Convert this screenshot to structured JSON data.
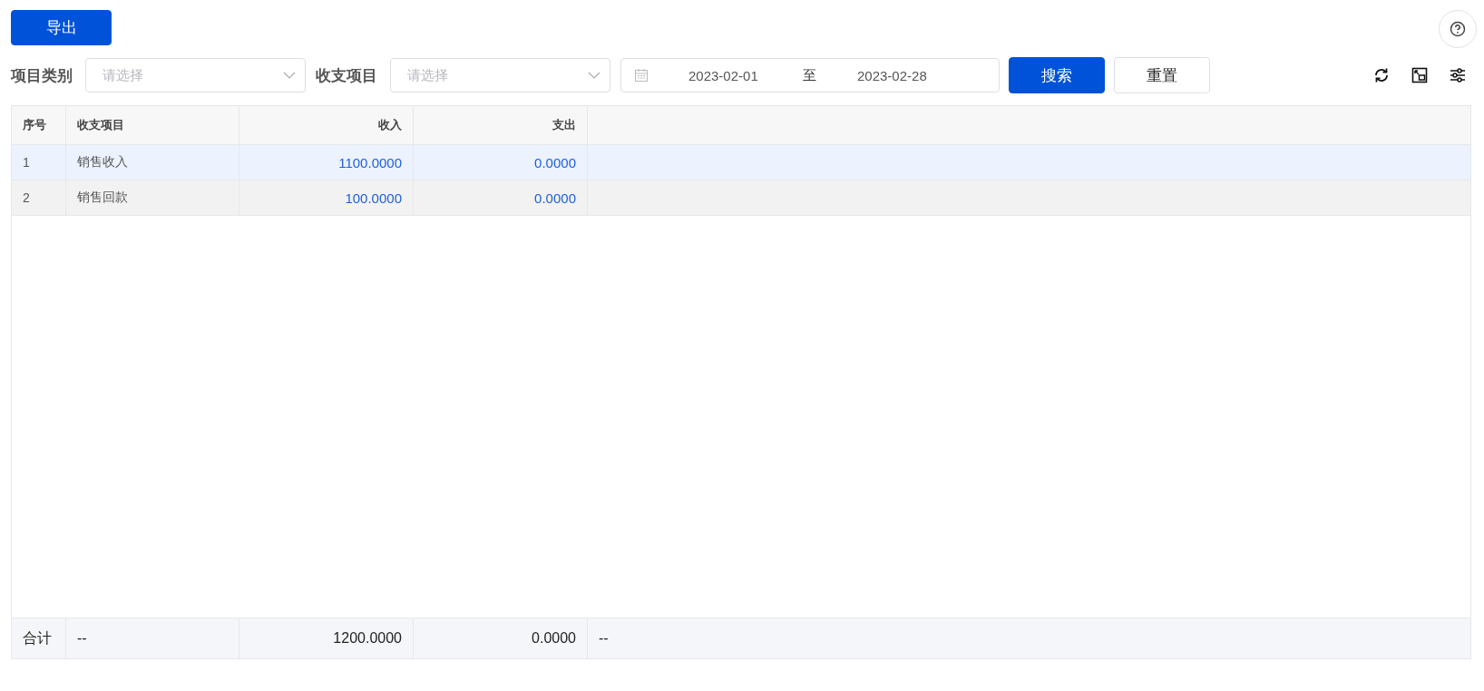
{
  "toolbar": {
    "export_button": "导出"
  },
  "filters": [
    {
      "label": "项目类别",
      "placeholder": "请选择"
    },
    {
      "label": "收支项目",
      "placeholder": "请选择"
    }
  ],
  "date_range": {
    "start": "2023-02-01",
    "separator": "至",
    "end": "2023-02-28"
  },
  "buttons": [
    {
      "label": "搜索",
      "kind": "primary"
    },
    {
      "label": "重置",
      "kind": "default"
    }
  ],
  "table": {
    "columns": [
      "序号",
      "收支项目",
      "收入",
      "支出"
    ],
    "rows": [
      {
        "cells": [
          "1",
          "销售收入",
          "1100.0000",
          "0.0000"
        ],
        "selected": true
      },
      {
        "cells": [
          "2",
          "销售回款",
          "100.0000",
          "0.0000"
        ],
        "selected": false
      }
    ],
    "footer": [
      "合计",
      "--",
      "1200.0000",
      "0.0000",
      "--"
    ]
  }
}
